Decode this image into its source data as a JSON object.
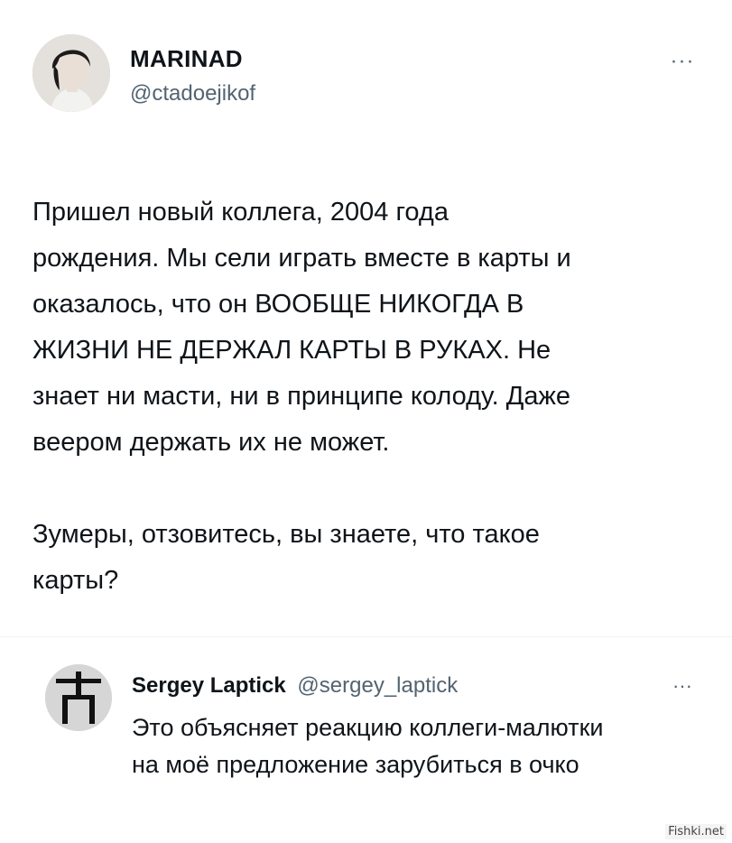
{
  "post": {
    "author_name": "MARINAD",
    "author_handle": "@ctadoejikof",
    "more_label": "···",
    "body_lines": [
      "Пришел новый коллега, 2004 года",
      "рождения. Мы сели играть вместе в карты и",
      "оказалось, что он ВООБЩЕ НИКОГДА В",
      "ЖИЗНИ НЕ ДЕРЖАЛ КАРТЫ В РУКАХ. Не",
      "знает ни масти, ни в принципе колоду. Даже",
      "веером держать их не может."
    ],
    "body_lines_2": [
      "Зумеры, отзовитесь, вы знаете, что такое",
      "карты?"
    ]
  },
  "reply": {
    "author_name": "Sergey Laptick",
    "author_handle": "@sergey_laptick",
    "more_label": "···",
    "text_lines": [
      "Это объясняет реакцию коллеги-малютки",
      "на моё предложение зарубиться в очко"
    ]
  },
  "watermark": "Fishki.net"
}
